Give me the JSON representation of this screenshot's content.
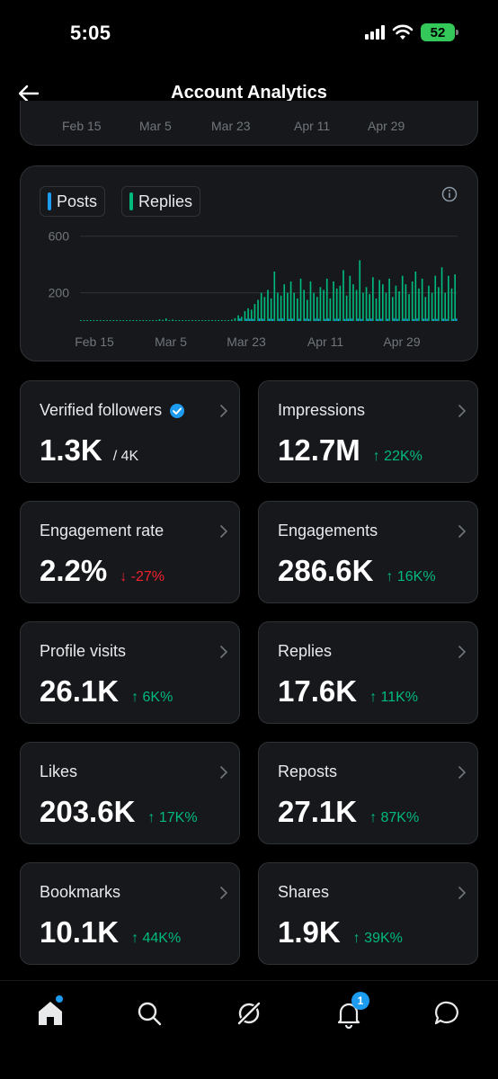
{
  "status": {
    "time": "5:05",
    "battery": "52"
  },
  "header": {
    "title": "Account Analytics"
  },
  "top_chart": {
    "ticks": [
      "Feb 15",
      "Mar 5",
      "Mar 23",
      "Apr 11",
      "Apr 29"
    ]
  },
  "legend": {
    "posts": "Posts",
    "replies": "Replies"
  },
  "colors": {
    "posts": "#1d9bf0",
    "replies": "#00ba7c",
    "card": "#16181c",
    "border": "#2f3336",
    "up": "#00ba7c",
    "down": "#f4212e"
  },
  "chart_data": {
    "type": "bar",
    "title": "",
    "xlabel": "",
    "ylabel": "",
    "y_ticks": [
      "600",
      "200"
    ],
    "x_ticks": [
      "Feb 15",
      "Mar 5",
      "Mar 23",
      "Apr 11",
      "Apr 29"
    ],
    "ylim": [
      0,
      700
    ],
    "grid": true,
    "series": [
      {
        "name": "Replies",
        "values": [
          2,
          3,
          2,
          4,
          3,
          2,
          3,
          2,
          5,
          3,
          2,
          4,
          2,
          3,
          3,
          2,
          4,
          3,
          2,
          3,
          2,
          3,
          4,
          3,
          12,
          8,
          18,
          6,
          10,
          5,
          4,
          3,
          2,
          4,
          3,
          2,
          5,
          3,
          2,
          3,
          4,
          2,
          3,
          5,
          4,
          6,
          10,
          20,
          40,
          30,
          70,
          90,
          80,
          120,
          150,
          200,
          170,
          220,
          160,
          350,
          200,
          180,
          260,
          200,
          280,
          200,
          160,
          300,
          220,
          150,
          280,
          200,
          170,
          240,
          220,
          300,
          160,
          280,
          230,
          250,
          360,
          180,
          320,
          260,
          220,
          430,
          200,
          240,
          190,
          310,
          160,
          290,
          260,
          200,
          300,
          170,
          250,
          210,
          320,
          260,
          190,
          280,
          350,
          230,
          300,
          170,
          250,
          200,
          320,
          240,
          380,
          200,
          320,
          230,
          330
        ]
      },
      {
        "name": "Posts",
        "values": [
          0,
          0,
          0,
          0,
          0,
          0,
          0,
          0,
          0,
          0,
          0,
          0,
          0,
          0,
          0,
          0,
          0,
          0,
          0,
          0,
          0,
          0,
          0,
          0,
          0,
          0,
          0,
          0,
          0,
          0,
          0,
          0,
          0,
          0,
          0,
          0,
          0,
          0,
          0,
          0,
          0,
          0,
          0,
          0,
          0,
          0,
          0,
          0,
          5,
          0,
          3,
          4,
          2,
          0,
          5,
          3,
          0,
          4,
          2,
          0,
          3,
          5,
          0,
          2,
          4,
          0,
          3,
          0,
          5,
          2,
          0,
          4,
          3,
          0,
          2,
          5,
          0,
          3,
          4,
          0,
          2,
          3,
          5,
          0,
          4,
          2,
          0,
          3,
          5,
          0,
          2,
          4,
          0,
          3,
          0,
          5,
          2,
          0,
          4,
          3,
          0,
          2,
          5,
          0,
          3,
          4,
          0,
          2,
          3,
          0,
          4,
          2,
          0,
          3,
          5
        ]
      }
    ]
  },
  "metrics": [
    {
      "label": "Verified followers",
      "value": "1.3K",
      "sub": "/ 4K",
      "delta": "",
      "dir": ""
    },
    {
      "label": "Impressions",
      "value": "12.7M",
      "sub": "",
      "delta": "↑ 22K%",
      "dir": "up"
    },
    {
      "label": "Engagement rate",
      "value": "2.2%",
      "sub": "",
      "delta": "↓ -27%",
      "dir": "down"
    },
    {
      "label": "Engagements",
      "value": "286.6K",
      "sub": "",
      "delta": "↑ 16K%",
      "dir": "up"
    },
    {
      "label": "Profile visits",
      "value": "26.1K",
      "sub": "",
      "delta": "↑ 6K%",
      "dir": "up"
    },
    {
      "label": "Replies",
      "value": "17.6K",
      "sub": "",
      "delta": "↑ 11K%",
      "dir": "up"
    },
    {
      "label": "Likes",
      "value": "203.6K",
      "sub": "",
      "delta": "↑ 17K%",
      "dir": "up"
    },
    {
      "label": "Reposts",
      "value": "27.1K",
      "sub": "",
      "delta": "↑ 87K%",
      "dir": "up"
    },
    {
      "label": "Bookmarks",
      "value": "10.1K",
      "sub": "",
      "delta": "↑ 44K%",
      "dir": "up"
    },
    {
      "label": "Shares",
      "value": "1.9K",
      "sub": "",
      "delta": "↑ 39K%",
      "dir": "up"
    }
  ],
  "tabs": {
    "notifications_badge": "1"
  }
}
